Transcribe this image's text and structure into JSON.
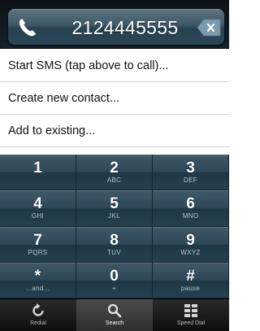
{
  "display": {
    "number": "2124445555",
    "call_icon": "phone-handset-icon",
    "clear_icon": "backspace-clear-icon"
  },
  "actions": [
    {
      "label": "Start SMS (tap above to call)..."
    },
    {
      "label": "Create new contact..."
    },
    {
      "label": "Add to existing..."
    }
  ],
  "keypad": [
    {
      "digit": "1",
      "letters": ""
    },
    {
      "digit": "2",
      "letters": "ABC"
    },
    {
      "digit": "3",
      "letters": "DEF"
    },
    {
      "digit": "4",
      "letters": "GHI"
    },
    {
      "digit": "5",
      "letters": "JKL"
    },
    {
      "digit": "6",
      "letters": "MNO"
    },
    {
      "digit": "7",
      "letters": "PQRS"
    },
    {
      "digit": "8",
      "letters": "TUV"
    },
    {
      "digit": "9",
      "letters": "WXYZ"
    },
    {
      "digit": "*",
      "letters": "...and..."
    },
    {
      "digit": "0",
      "letters": "+"
    },
    {
      "digit": "#",
      "letters": "pause"
    }
  ],
  "tabs": [
    {
      "label": "Redial",
      "icon": "redial-icon",
      "active": false
    },
    {
      "label": "Search",
      "icon": "search-icon",
      "active": true
    },
    {
      "label": "Speed Dial",
      "icon": "speed-dial-grid-icon",
      "active": false
    }
  ],
  "colors": {
    "display_bg": "#3e5766",
    "keypad_bg": "#2a4352",
    "tabbar_bg": "#1a1a1a"
  }
}
